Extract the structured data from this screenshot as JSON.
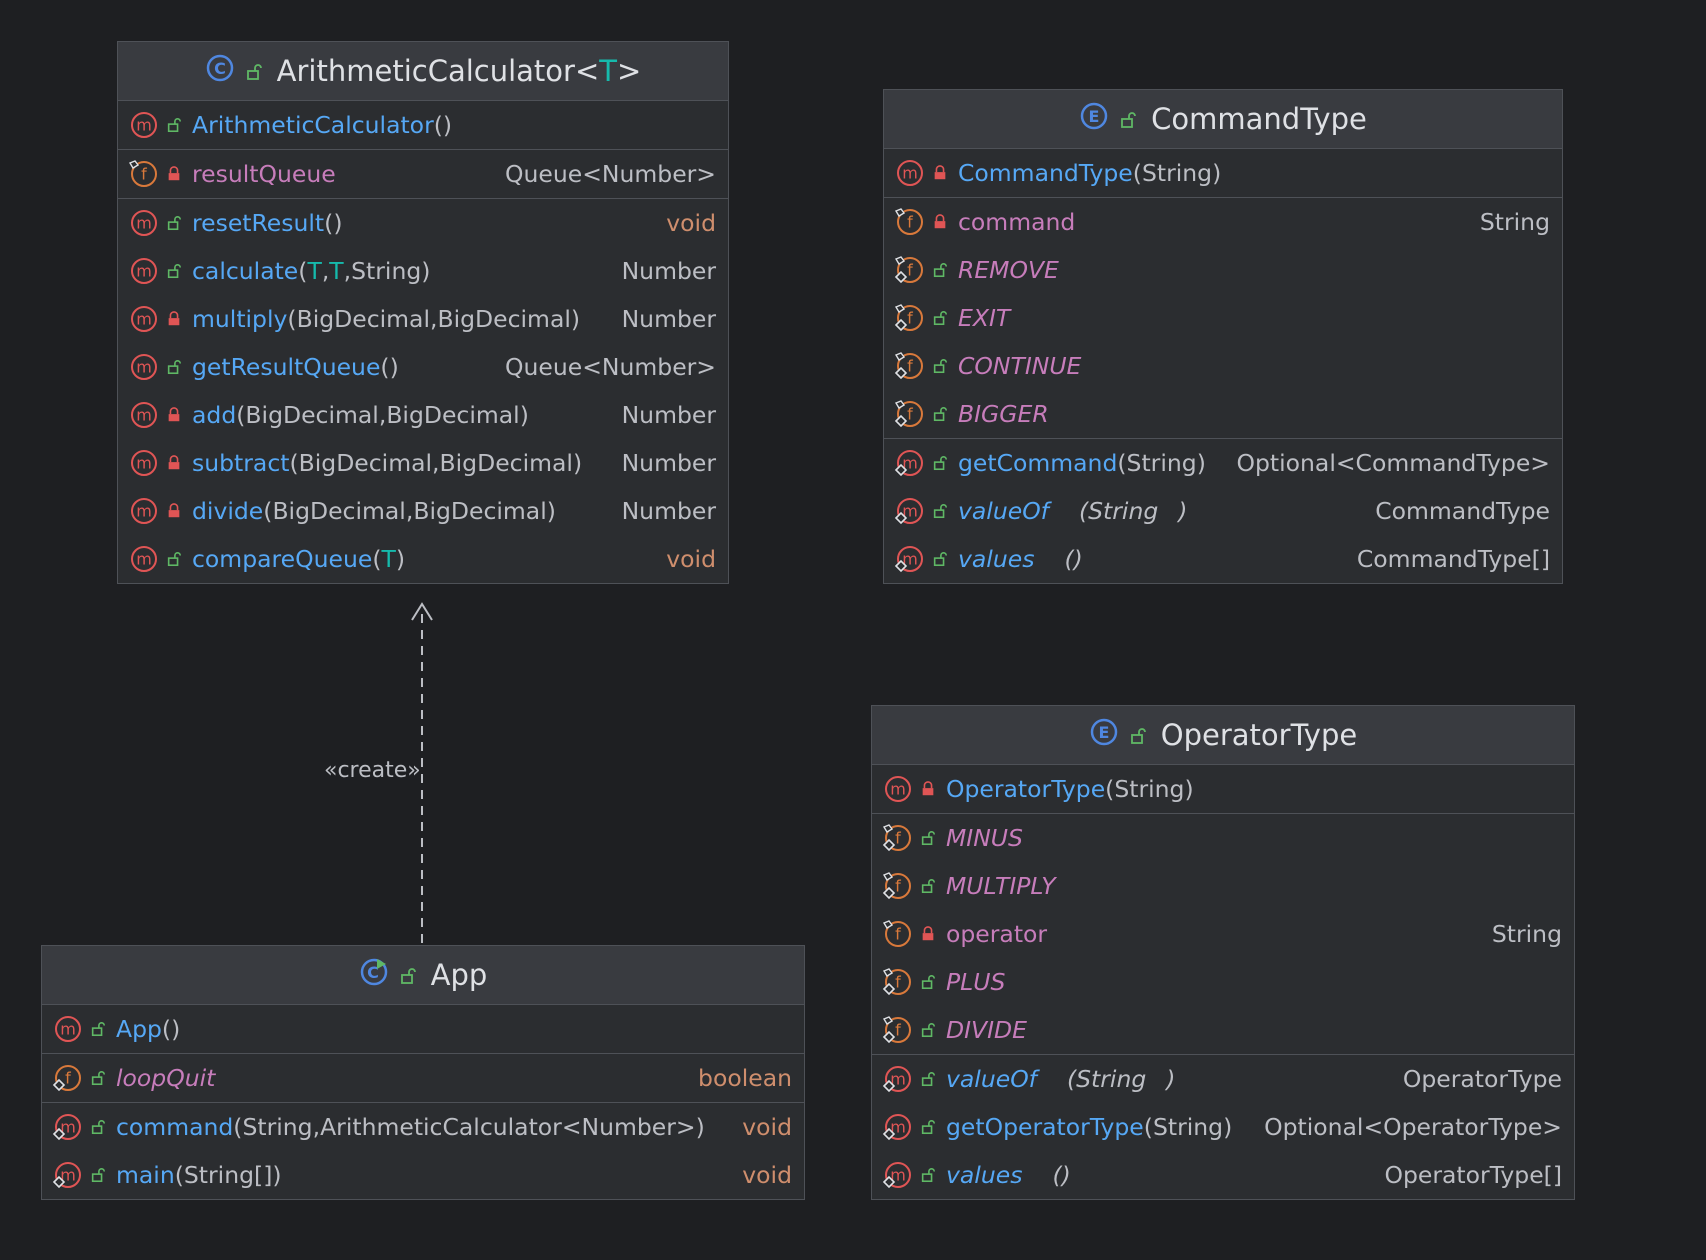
{
  "colors": {
    "background": "#1e1f22",
    "box_fill": "#2b2d30",
    "header_fill": "#393b40",
    "border": "#4e5157",
    "method_name": "#56a8f5",
    "field_name": "#c77dbb",
    "type_param": "#16baac",
    "void_return": "#cf8e6d",
    "plain_text": "#bcbec4",
    "method_icon": "#e05555",
    "field_icon": "#d9793b",
    "class_icon": "#4f87e0",
    "public_lock": "#5fb865",
    "private_lock": "#e05555"
  },
  "relation": {
    "label": "«create»"
  },
  "classes": {
    "calc": {
      "kind_icon": "class-icon",
      "visibility": "public",
      "name": "ArithmeticCalculator",
      "generic_open": "<",
      "generic_param": "T",
      "generic_close": ">",
      "sections": [
        [
          {
            "kind": "method",
            "visibility": "public",
            "name": "ArithmeticCalculator",
            "params": [],
            "ret": ""
          }
        ],
        [
          {
            "kind": "field",
            "visibility": "private",
            "name": "resultQueue",
            "ret": "Queue<Number>",
            "final": true
          }
        ],
        [
          {
            "kind": "method",
            "visibility": "public",
            "name": "resetResult",
            "params": [],
            "ret": "void"
          },
          {
            "kind": "method",
            "visibility": "public",
            "name": "calculate",
            "params": [
              "T",
              "T",
              "String"
            ],
            "ret": "Number"
          },
          {
            "kind": "method",
            "visibility": "private",
            "name": "multiply",
            "params": [
              "BigDecimal",
              "BigDecimal"
            ],
            "ret": "Number"
          },
          {
            "kind": "method",
            "visibility": "public",
            "name": "getResultQueue",
            "params": [],
            "ret": "Queue<Number>"
          },
          {
            "kind": "method",
            "visibility": "private",
            "name": "add",
            "params": [
              "BigDecimal",
              "BigDecimal"
            ],
            "ret": "Number"
          },
          {
            "kind": "method",
            "visibility": "private",
            "name": "subtract",
            "params": [
              "BigDecimal",
              "BigDecimal"
            ],
            "ret": "Number"
          },
          {
            "kind": "method",
            "visibility": "private",
            "name": "divide",
            "params": [
              "BigDecimal",
              "BigDecimal"
            ],
            "ret": "Number"
          },
          {
            "kind": "method",
            "visibility": "public",
            "name": "compareQueue",
            "params": [
              "T"
            ],
            "ret": "void"
          }
        ]
      ]
    },
    "command": {
      "kind_icon": "enum-icon",
      "visibility": "public",
      "name": "CommandType",
      "sections": [
        [
          {
            "kind": "method",
            "visibility": "private",
            "name": "CommandType",
            "params": [
              "String"
            ],
            "ret": ""
          }
        ],
        [
          {
            "kind": "field",
            "visibility": "private",
            "name": "command",
            "ret": "String",
            "final": true
          },
          {
            "kind": "field",
            "visibility": "public",
            "name": "REMOVE",
            "ret": "",
            "static": true,
            "final": true
          },
          {
            "kind": "field",
            "visibility": "public",
            "name": "EXIT",
            "ret": "",
            "static": true,
            "final": true
          },
          {
            "kind": "field",
            "visibility": "public",
            "name": "CONTINUE",
            "ret": "",
            "static": true,
            "final": true
          },
          {
            "kind": "field",
            "visibility": "public",
            "name": "BIGGER",
            "ret": "",
            "static": true,
            "final": true
          }
        ],
        [
          {
            "kind": "method",
            "visibility": "public",
            "name": "getCommand",
            "params": [
              "String"
            ],
            "ret": "Optional<CommandType>",
            "static": true
          },
          {
            "kind": "method",
            "visibility": "public",
            "name": "valueOf",
            "params": [
              "String"
            ],
            "ret": "CommandType",
            "static": true,
            "spaced": true
          },
          {
            "kind": "method",
            "visibility": "public",
            "name": "values",
            "params": [],
            "ret": "CommandType[]",
            "static": true,
            "spaced": true
          }
        ]
      ]
    },
    "operator": {
      "kind_icon": "enum-icon",
      "visibility": "public",
      "name": "OperatorType",
      "sections": [
        [
          {
            "kind": "method",
            "visibility": "private",
            "name": "OperatorType",
            "params": [
              "String"
            ],
            "ret": ""
          }
        ],
        [
          {
            "kind": "field",
            "visibility": "public",
            "name": "MINUS",
            "ret": "",
            "static": true,
            "final": true
          },
          {
            "kind": "field",
            "visibility": "public",
            "name": "MULTIPLY",
            "ret": "",
            "static": true,
            "final": true
          },
          {
            "kind": "field",
            "visibility": "private",
            "name": "operator",
            "ret": "String",
            "final": true
          },
          {
            "kind": "field",
            "visibility": "public",
            "name": "PLUS",
            "ret": "",
            "static": true,
            "final": true
          },
          {
            "kind": "field",
            "visibility": "public",
            "name": "DIVIDE",
            "ret": "",
            "static": true,
            "final": true
          }
        ],
        [
          {
            "kind": "method",
            "visibility": "public",
            "name": "valueOf",
            "params": [
              "String"
            ],
            "ret": "OperatorType",
            "static": true,
            "spaced": true
          },
          {
            "kind": "method",
            "visibility": "public",
            "name": "getOperatorType",
            "params": [
              "String"
            ],
            "ret": "Optional<OperatorType>",
            "static": true
          },
          {
            "kind": "method",
            "visibility": "public",
            "name": "values",
            "params": [],
            "ret": "OperatorType[]",
            "static": true,
            "spaced": true
          }
        ]
      ]
    },
    "app": {
      "kind_icon": "runnable-class-icon",
      "visibility": "public",
      "name": "App",
      "sections": [
        [
          {
            "kind": "method",
            "visibility": "public",
            "name": "App",
            "params": [],
            "ret": ""
          }
        ],
        [
          {
            "kind": "field",
            "visibility": "public",
            "name": "loopQuit",
            "ret": "boolean",
            "static": true
          }
        ],
        [
          {
            "kind": "method",
            "visibility": "public",
            "name": "command",
            "params": [
              "String",
              "ArithmeticCalculator<Number>"
            ],
            "ret": "void",
            "static": true
          },
          {
            "kind": "method",
            "visibility": "public",
            "name": "main",
            "params": [
              "String[]"
            ],
            "ret": "void",
            "static": true
          }
        ]
      ]
    }
  }
}
